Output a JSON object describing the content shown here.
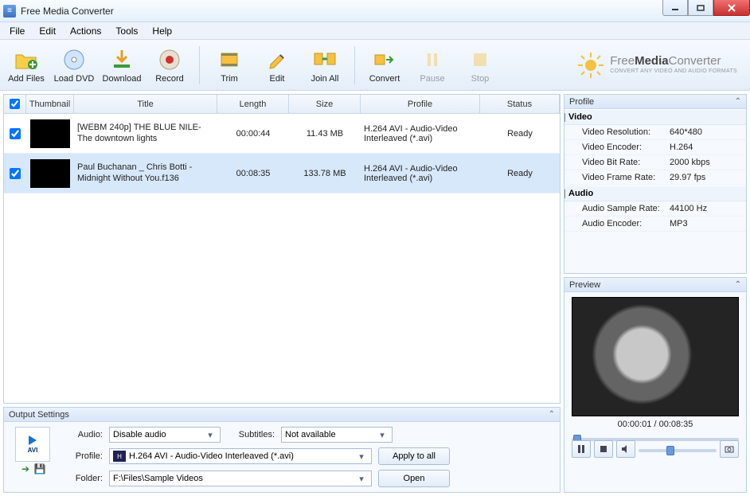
{
  "window": {
    "title": "Free Media Converter"
  },
  "menu": {
    "file": "File",
    "edit": "Edit",
    "actions": "Actions",
    "tools": "Tools",
    "help": "Help"
  },
  "toolbar": {
    "add_files": "Add Files",
    "load_dvd": "Load DVD",
    "download": "Download",
    "record": "Record",
    "trim": "Trim",
    "edit": "Edit",
    "join_all": "Join All",
    "convert": "Convert",
    "pause": "Pause",
    "stop": "Stop"
  },
  "brand": {
    "name_html": "FreeMediaConverter",
    "tagline": "CONVERT ANY VIDEO AND AUDIO FORMATS"
  },
  "columns": {
    "thumbnail": "Thumbnail",
    "title": "Title",
    "length": "Length",
    "size": "Size",
    "profile": "Profile",
    "status": "Status"
  },
  "files": [
    {
      "checked": true,
      "title": "[WEBM 240p] THE BLUE NILE- The downtown lights",
      "length": "00:00:44",
      "size": "11.43 MB",
      "profile": "H.264 AVI - Audio-Video Interleaved (*.avi)",
      "status": "Ready",
      "selected": false
    },
    {
      "checked": true,
      "title": "Paul Buchanan _ Chris Botti - Midnight Without You.f136",
      "length": "00:08:35",
      "size": "133.78 MB",
      "profile": "H.264 AVI - Audio-Video Interleaved (*.avi)",
      "status": "Ready",
      "selected": true
    }
  ],
  "output": {
    "panel_title": "Output Settings",
    "format_badge": "AVI",
    "audio_label": "Audio:",
    "audio_value": "Disable audio",
    "subtitles_label": "Subtitles:",
    "subtitles_value": "Not available",
    "profile_label": "Profile:",
    "profile_value": "H.264 AVI - Audio-Video Interleaved (*.avi)",
    "folder_label": "Folder:",
    "folder_value": "F:\\Files\\Sample Videos",
    "apply_all": "Apply to all",
    "open": "Open"
  },
  "profile_panel": {
    "title": "Profile",
    "video_section": "Video",
    "video_resolution_k": "Video Resolution:",
    "video_resolution_v": "640*480",
    "video_encoder_k": "Video Encoder:",
    "video_encoder_v": "H.264",
    "video_bitrate_k": "Video Bit Rate:",
    "video_bitrate_v": "2000 kbps",
    "video_framerate_k": "Video Frame Rate:",
    "video_framerate_v": "29.97 fps",
    "audio_section": "Audio",
    "audio_samplerate_k": "Audio Sample Rate:",
    "audio_samplerate_v": "44100 Hz",
    "audio_encoder_k": "Audio Encoder:",
    "audio_encoder_v": "MP3"
  },
  "preview": {
    "title": "Preview",
    "time": "00:00:01 / 00:08:35"
  }
}
